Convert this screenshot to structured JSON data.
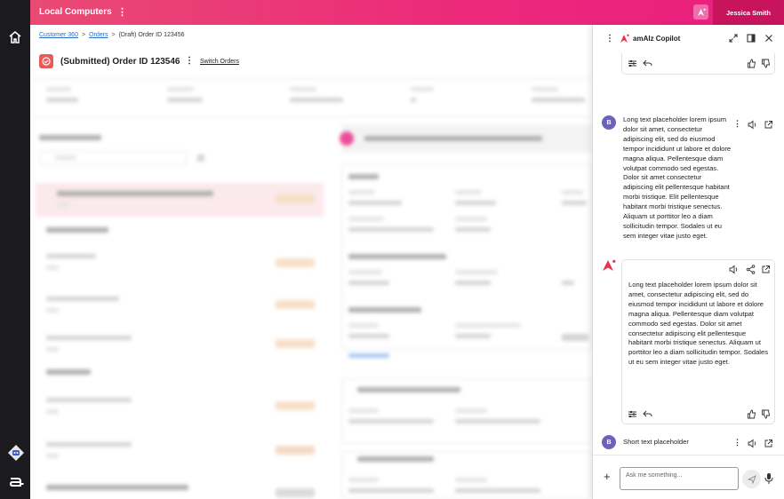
{
  "app": {
    "title": "Local Computers",
    "user_name": "Jessica Smith"
  },
  "icons": {
    "home": "home-icon",
    "app_logo": "ai-sparkle-icon",
    "more": "kebab-icon"
  },
  "breadcrumb": {
    "items": [
      "Customer 360",
      "Orders",
      "(Draft) Order ID 123456"
    ],
    "separator": ">"
  },
  "order": {
    "title": "(Submitted) Order ID 123546",
    "switch_label": "Switch Orders",
    "status_color": "#e85b58"
  },
  "copilot": {
    "title": "amAIz Copilot",
    "messages": [
      {
        "role": "user",
        "avatar": "B",
        "text": "Long text placeholder lorem ipsum dolor sit amet, consectetur adipiscing elit, sed do eiusmod tempor incididunt ut labore et dolore magna aliqua. Pellentesque diam volutpat commodo sed egestas. Dolor sit amet consectetur adipiscing elit pellentesque habitant morbi tristique. Elit pellentesque habitant morbi tristique senectus. Aliquam ut porttitor leo a diam sollicitudin tempor. Sodales ut eu sem integer vitae justo eget."
      },
      {
        "role": "assistant",
        "text": "Long text placeholder lorem ipsum dolor sit amet, consectetur adipiscing elit, sed do eiusmod tempor incididunt ut labore et dolore magna aliqua. Pellentesque diam volutpat commodo sed egestas. Dolor sit amet consectetur adipiscing elit pellentesque habitant morbi tristique senectus. Aliquam ut porttitor leo a diam sollicitudin tempor. Sodales ut eu sem integer vitae justo eget."
      },
      {
        "role": "user",
        "avatar": "B",
        "text": "Short text placeholder"
      }
    ],
    "input_placeholder": "Ask me something..."
  },
  "colors": {
    "brand_start": "#e94a74",
    "brand_end": "#e91e80",
    "user_badge": "#c8145d",
    "avatar": "#6c63b8",
    "accent_red": "#e8334a"
  }
}
